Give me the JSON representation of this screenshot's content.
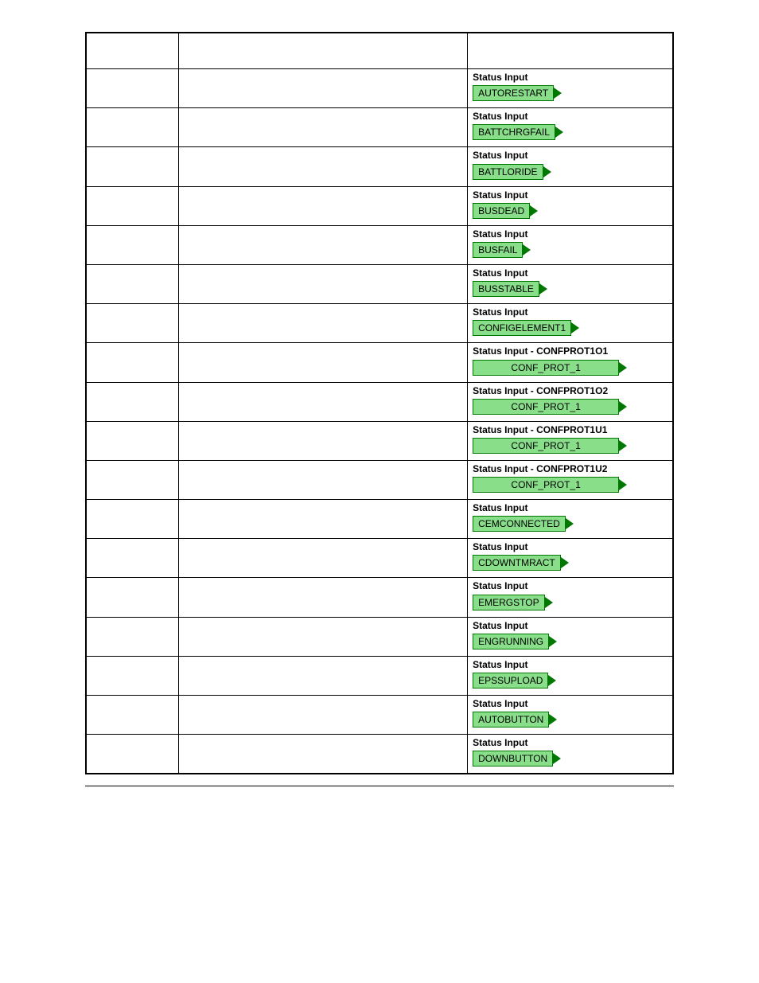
{
  "defaultLabel": "Status Input",
  "rows": [
    {
      "label": "Status Input",
      "block": "AUTORESTART",
      "wide": false
    },
    {
      "label": "Status Input",
      "block": "BATTCHRGFAIL",
      "wide": false
    },
    {
      "label": "Status Input",
      "block": "BATTLORIDE",
      "wide": false
    },
    {
      "label": "Status Input",
      "block": "BUSDEAD",
      "wide": false
    },
    {
      "label": "Status Input",
      "block": "BUSFAIL",
      "wide": false
    },
    {
      "label": "Status Input",
      "block": "BUSSTABLE",
      "wide": false
    },
    {
      "label": "Status Input",
      "block": "CONFIGELEMENT1",
      "wide": false
    },
    {
      "label": "Status Input - CONFPROT1O1",
      "block": "CONF_PROT_1",
      "wide": true
    },
    {
      "label": "Status Input - CONFPROT1O2",
      "block": "CONF_PROT_1",
      "wide": true
    },
    {
      "label": "Status Input - CONFPROT1U1",
      "block": "CONF_PROT_1",
      "wide": true
    },
    {
      "label": "Status Input - CONFPROT1U2",
      "block": "CONF_PROT_1",
      "wide": true
    },
    {
      "label": "Status Input",
      "block": "CEMCONNECTED",
      "wide": false
    },
    {
      "label": "Status Input",
      "block": "CDOWNTMRACT",
      "wide": false
    },
    {
      "label": "Status Input",
      "block": "EMERGSTOP",
      "wide": false
    },
    {
      "label": "Status Input",
      "block": "ENGRUNNING",
      "wide": false
    },
    {
      "label": "Status Input",
      "block": "EPSSUPLOAD",
      "wide": false
    },
    {
      "label": "Status Input",
      "block": "AUTOBUTTON",
      "wide": false
    },
    {
      "label": "Status Input",
      "block": "DOWNBUTTON",
      "wide": false
    }
  ]
}
